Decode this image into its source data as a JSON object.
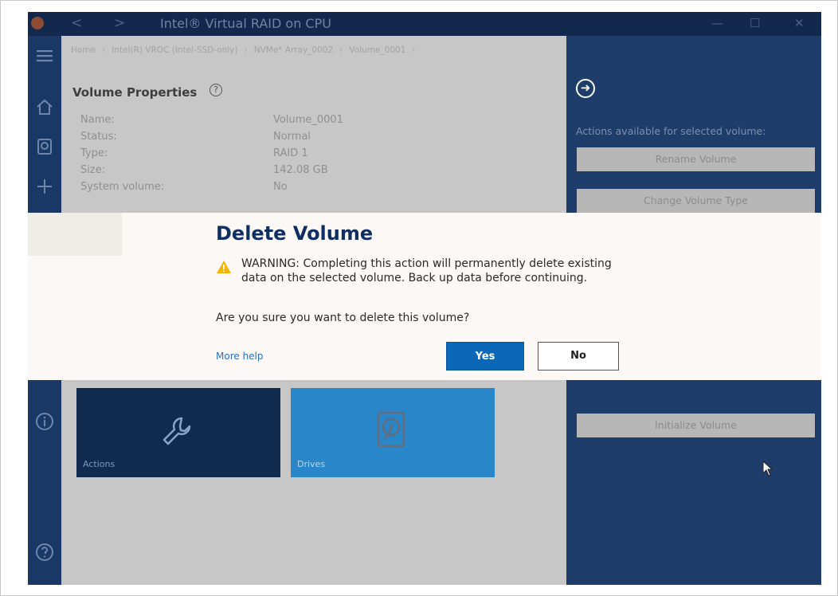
{
  "window": {
    "title": "Intel® Virtual RAID on CPU",
    "back_glyph": "<",
    "forward_glyph": ">",
    "minimize_glyph": "—",
    "maximize_glyph": "☐",
    "close_glyph": "✕"
  },
  "breadcrumb": {
    "items": [
      "Home",
      "Intel(R) VROC (Intel-SSD-only)",
      "NVMe* Array_0002",
      "Volume_0001"
    ],
    "separator": "›"
  },
  "volume_properties": {
    "title": "Volume Properties",
    "help_glyph": "?",
    "rows": [
      {
        "label": "Name:",
        "value": "Volume_0001"
      },
      {
        "label": "Status:",
        "value": "Normal"
      },
      {
        "label": "Type:",
        "value": "RAID 1"
      },
      {
        "label": "Size:",
        "value": "142.08 GB"
      },
      {
        "label": "System volume:",
        "value": "No"
      }
    ]
  },
  "tiles": {
    "actions_label": "Actions",
    "drives_label": "Drives"
  },
  "panel": {
    "caption": "Actions available for selected volume:",
    "buttons": [
      "Rename Volume",
      "Change Volume Type",
      "Initialize Volume"
    ]
  },
  "dialog": {
    "title": "Delete Volume",
    "warning": "WARNING: Completing this action will permanently delete existing data on the selected volume. Back up data before continuing.",
    "question": "Are you sure you want to delete this volume?",
    "help_link": "More help",
    "yes_label": "Yes",
    "no_label": "No"
  },
  "colors": {
    "accent": "#0b67b8",
    "title_navy": "#0f2f63",
    "warning_yellow": "#f5b400"
  },
  "icons": [
    "menu-icon",
    "home-icon",
    "drive-icon",
    "plus-icon",
    "info-icon",
    "help-icon",
    "wrench-icon",
    "warning-icon",
    "arrow-right-icon",
    "cursor-icon"
  ]
}
